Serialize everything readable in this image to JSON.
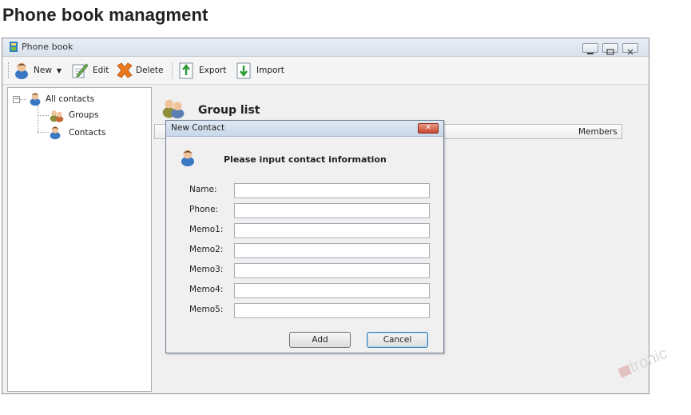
{
  "heading": "Phone book managment",
  "window": {
    "title": "Phone book",
    "controls": [
      "minimize-icon",
      "maximize-icon",
      "close-icon"
    ]
  },
  "toolbar": {
    "new_label": "New",
    "edit_label": "Edit",
    "delete_label": "Delete",
    "export_label": "Export",
    "import_label": "Import"
  },
  "tree": {
    "root": "All contacts",
    "children": [
      "Groups",
      "Contacts"
    ]
  },
  "main": {
    "title": "Group list",
    "columns": [
      "Members"
    ]
  },
  "dialog": {
    "title": "New Contact",
    "heading": "Please input contact information",
    "fields": [
      {
        "label": "Name:",
        "value": ""
      },
      {
        "label": "Phone:",
        "value": ""
      },
      {
        "label": "Memo1:",
        "value": ""
      },
      {
        "label": "Memo2:",
        "value": ""
      },
      {
        "label": "Memo3:",
        "value": ""
      },
      {
        "label": "Memo4:",
        "value": ""
      },
      {
        "label": "Memo5:",
        "value": ""
      }
    ],
    "add_label": "Add",
    "cancel_label": "Cancel"
  },
  "watermark": "tronic",
  "colors": {
    "titlebar": "#dde5ef",
    "close_button": "#c8452d",
    "contact_icon": "#3b78c4"
  }
}
